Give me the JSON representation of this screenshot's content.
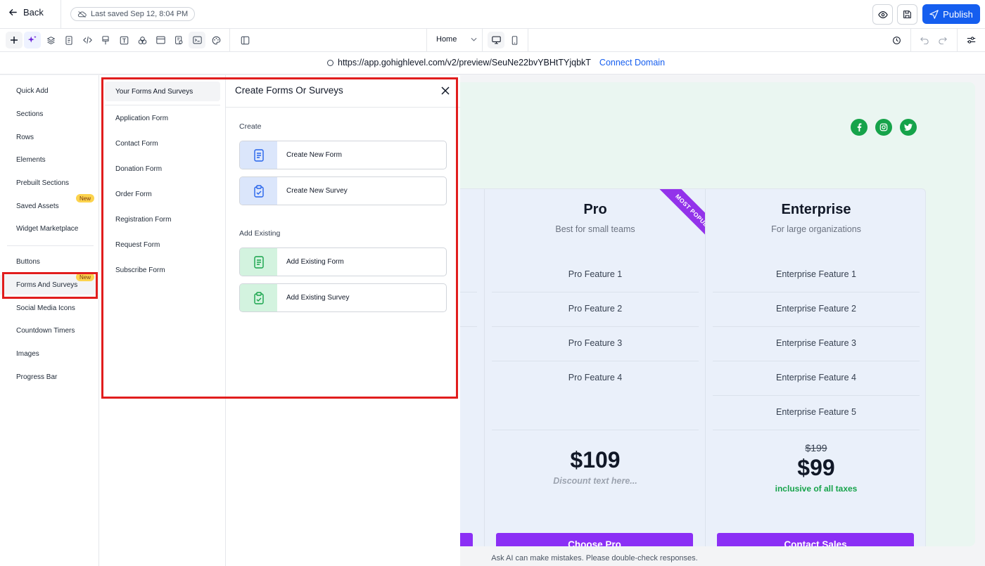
{
  "topbar": {
    "back_label": "Back",
    "saved_text": "Last saved Sep 12, 8:04 PM",
    "publish_label": "Publish"
  },
  "toolbar": {
    "page_select": "Home"
  },
  "urlbar": {
    "url": "https://app.gohighlevel.com/v2/preview/SeuNe22bvYBHtTYjqbkT",
    "connect_label": "Connect Domain"
  },
  "sidebar": {
    "items": [
      {
        "label": "Quick Add"
      },
      {
        "label": "Sections"
      },
      {
        "label": "Rows"
      },
      {
        "label": "Elements"
      },
      {
        "label": "Prebuilt Sections"
      },
      {
        "label": "Saved Assets",
        "badge": "New"
      },
      {
        "label": "Widget Marketplace"
      },
      {
        "label": "Buttons"
      },
      {
        "label": "Forms And Surveys",
        "badge": "New"
      },
      {
        "label": "Social Media Icons"
      },
      {
        "label": "Countdown Timers"
      },
      {
        "label": "Images"
      },
      {
        "label": "Progress Bar"
      }
    ]
  },
  "forms_panel": {
    "header": "Your Forms And Surveys",
    "items": [
      "Application Form",
      "Contact Form",
      "Donation Form",
      "Order Form",
      "Registration Form",
      "Request Form",
      "Subscribe Form"
    ]
  },
  "create_panel": {
    "title": "Create Forms Or Surveys",
    "create_label": "Create",
    "create_new_form": "Create New Form",
    "create_new_survey": "Create New Survey",
    "add_existing_label": "Add Existing",
    "add_existing_form": "Add Existing Form",
    "add_existing_survey": "Add Existing Survey"
  },
  "pricing": {
    "pro": {
      "name": "Pro",
      "subtitle": "Best for small teams",
      "ribbon": "MOST POPULAR",
      "features": [
        "Pro Feature 1",
        "Pro Feature 2",
        "Pro Feature 3",
        "Pro Feature 4"
      ],
      "price": "$109",
      "discount_text": "Discount text here...",
      "cta": "Choose Pro"
    },
    "enterprise": {
      "name": "Enterprise",
      "subtitle": "For large organizations",
      "features": [
        "Enterprise Feature 1",
        "Enterprise Feature 2",
        "Enterprise Feature 3",
        "Enterprise Feature 4",
        "Enterprise Feature 5"
      ],
      "old_price": "$199",
      "price": "$99",
      "tax_text": "inclusive of all taxes",
      "cta": "Contact Sales"
    }
  },
  "footer_note": "Ask AI can make mistakes. Please double-check responses.",
  "colors": {
    "accent": "#155eef",
    "highlight": "#e11d1d",
    "cta_purple": "#8b2ff5",
    "social_green": "#16a34a"
  }
}
